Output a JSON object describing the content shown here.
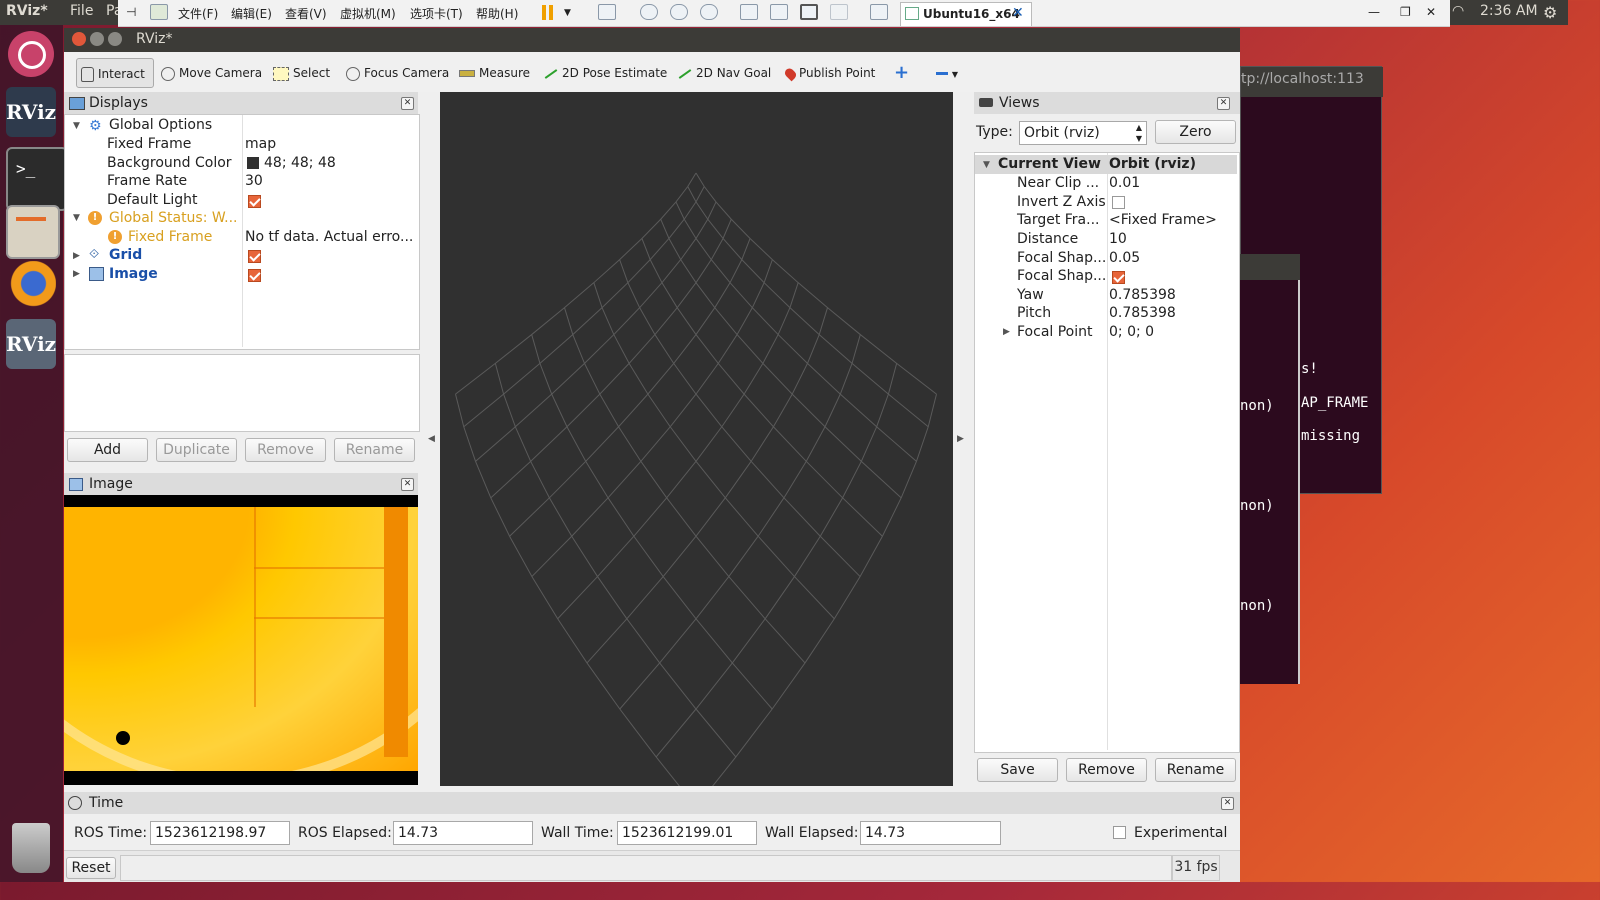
{
  "system": {
    "app_name": "RViz*",
    "menu_file": "File",
    "menu_partial": "Pa",
    "clock": "2:36 AM"
  },
  "vm": {
    "menus": [
      "文件(F)",
      "编辑(E)",
      "查看(V)",
      "虚拟机(M)",
      "选项卡(T)",
      "帮助(H)"
    ],
    "tab_label": "Ubuntu16_x64"
  },
  "terminal": {
    "url": "tp://localhost:113",
    "lines": [
      "s!",
      "AP_FRAME",
      "missing"
    ],
    "partial_lines": [
      "non)",
      "non)",
      "non)"
    ]
  },
  "window": {
    "title": "RViz*"
  },
  "toolbar": {
    "interact": "Interact",
    "move_camera": "Move Camera",
    "select": "Select",
    "focus_camera": "Focus Camera",
    "measure": "Measure",
    "pose_estimate": "2D Pose Estimate",
    "nav_goal": "2D Nav Goal",
    "publish_point": "Publish Point"
  },
  "displays": {
    "title": "Displays",
    "global_options": "Global Options",
    "fixed_frame_label": "Fixed Frame",
    "fixed_frame_value": "map",
    "bg_color_label": "Background Color",
    "bg_color_value": "48; 48; 48",
    "frame_rate_label": "Frame Rate",
    "frame_rate_value": "30",
    "default_light_label": "Default Light",
    "global_status_label": "Global Status: W...",
    "status_fixed_frame_label": "Fixed Frame",
    "status_fixed_frame_value": "No tf data.  Actual erro...",
    "grid_label": "Grid",
    "image_label": "Image",
    "buttons": {
      "add": "Add",
      "duplicate": "Duplicate",
      "remove": "Remove",
      "rename": "Rename"
    }
  },
  "image_panel": {
    "title": "Image"
  },
  "views": {
    "title": "Views",
    "type_label": "Type:",
    "type_value": "Orbit (rviz)",
    "zero_button": "Zero",
    "current_view_label": "Current View",
    "current_view_value": "Orbit (rviz)",
    "props": [
      {
        "label": "Near Clip ...",
        "value": "0.01"
      },
      {
        "label": "Invert Z Axis",
        "value": ""
      },
      {
        "label": "Target Fra...",
        "value": "<Fixed Frame>"
      },
      {
        "label": "Distance",
        "value": "10"
      },
      {
        "label": "Focal Shap...",
        "value": "0.05"
      },
      {
        "label": "Focal Shap...",
        "value": ""
      },
      {
        "label": "Yaw",
        "value": "0.785398"
      },
      {
        "label": "Pitch",
        "value": "0.785398"
      },
      {
        "label": "Focal Point",
        "value": "0; 0; 0"
      }
    ],
    "buttons": {
      "save": "Save",
      "remove": "Remove",
      "rename": "Rename"
    }
  },
  "time": {
    "title": "Time",
    "ros_time_label": "ROS Time:",
    "ros_time_value": "1523612198.97",
    "ros_elapsed_label": "ROS Elapsed:",
    "ros_elapsed_value": "14.73",
    "wall_time_label": "Wall Time:",
    "wall_time_value": "1523612199.01",
    "wall_elapsed_label": "Wall Elapsed:",
    "wall_elapsed_value": "14.73",
    "experimental_label": "Experimental"
  },
  "status": {
    "reset_button": "Reset",
    "fps": "31 fps"
  },
  "colors": {
    "viewport_bg": "#303030",
    "grid_line": "#5a5a5a",
    "accent_check": "#e7653a",
    "link_blue": "#1a4fa8"
  }
}
